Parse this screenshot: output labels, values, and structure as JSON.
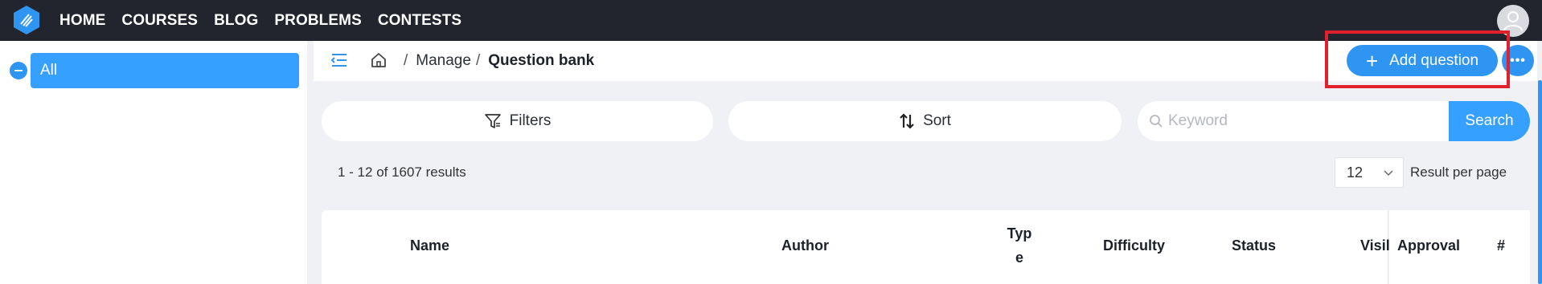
{
  "nav": {
    "items": [
      "HOME",
      "COURSES",
      "BLOG",
      "PROBLEMS",
      "CONTESTS"
    ]
  },
  "sidebar": {
    "tree_root": "All"
  },
  "breadcrumb": {
    "manage": "Manage",
    "separator": "/",
    "current": "Question bank"
  },
  "actions": {
    "add_question": "Add question",
    "more": "•••"
  },
  "toolbar": {
    "filters": "Filters",
    "sort": "Sort",
    "search_placeholder": "Keyword",
    "search_button": "Search"
  },
  "results": {
    "summary": "1 - 12 of 1607 results",
    "per_page_value": "12",
    "per_page_label": "Result per page"
  },
  "table": {
    "columns": {
      "name": "Name",
      "author": "Author",
      "type_line1": "Typ",
      "type_line2": "e",
      "difficulty": "Difficulty",
      "status": "Status",
      "visibility": "Visil",
      "approval": "Approval",
      "number": "#"
    }
  },
  "colors": {
    "topbar": "#22252d",
    "accent": "#2f95f3",
    "highlight": "#e0202a",
    "background": "#f0f1f4"
  },
  "icons": [
    "logo-icon",
    "avatar-icon",
    "collapse-icon",
    "menu-toggle-icon",
    "home-icon",
    "plus-icon",
    "more-icon",
    "filter-icon",
    "sort-icon",
    "search-icon",
    "chevron-down-icon"
  ]
}
